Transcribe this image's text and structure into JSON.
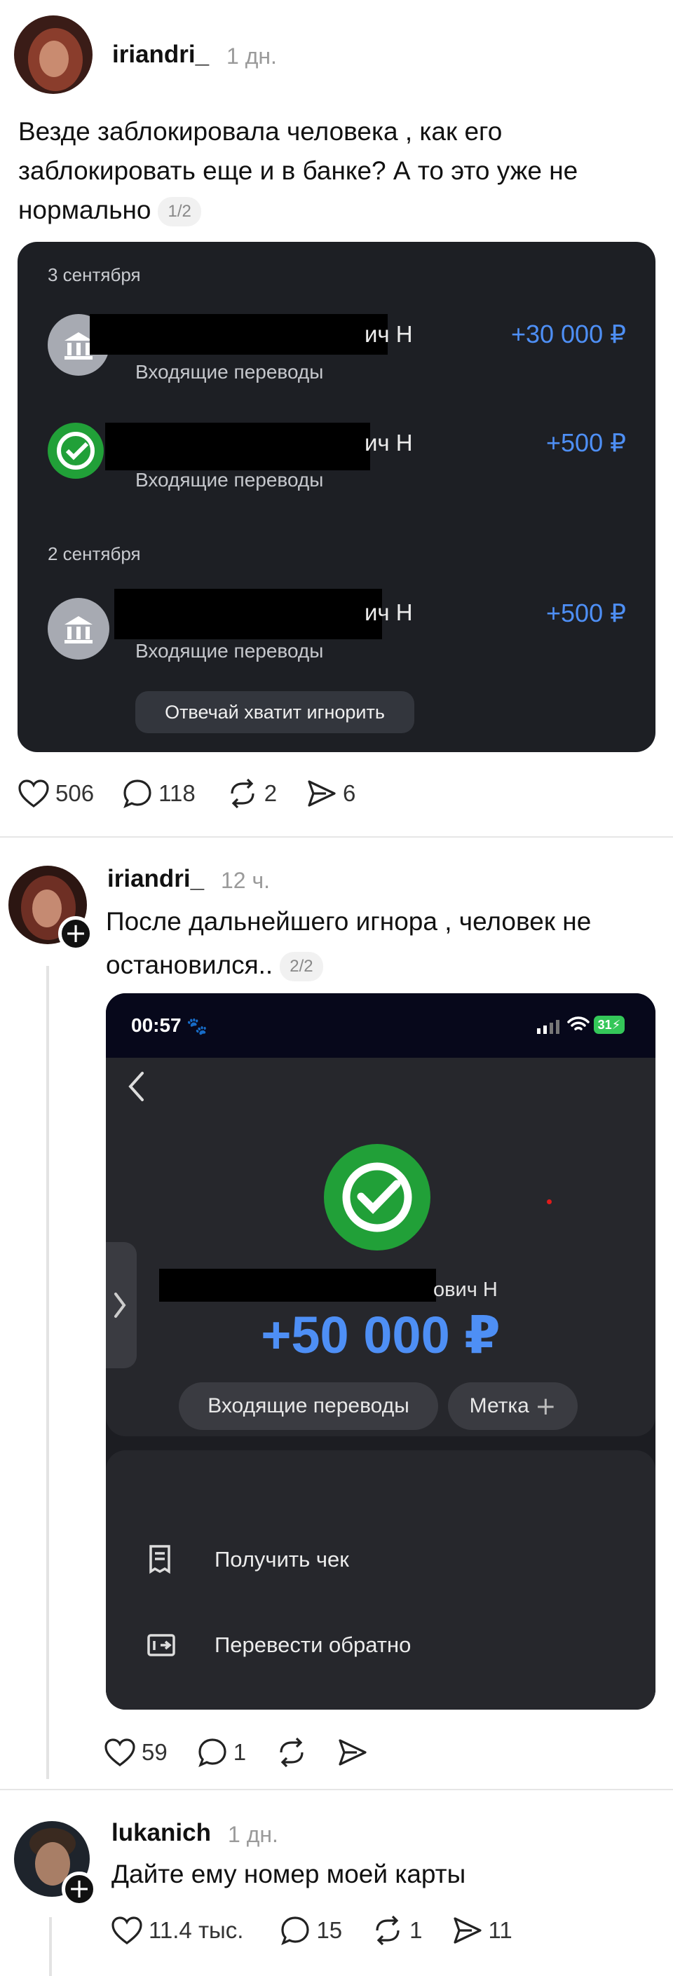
{
  "posts": [
    {
      "username": "iriandri_",
      "time": "1 дн.",
      "text": "Везде заблокировала человека , как его заблокировать еще и в банке? А то это уже не нормально",
      "counter": "1/2",
      "actions": {
        "likes": "506",
        "comments": "118",
        "reposts": "2",
        "shares": "6"
      }
    },
    {
      "username": "iriandri_",
      "time": "12 ч.",
      "text": "После дальнейшего игнора , человек не остановился..",
      "counter": "2/2",
      "actions": {
        "likes": "59",
        "comments": "1"
      }
    },
    {
      "username": "lukanich",
      "time": "1 дн.",
      "text": "Дайте ему номер моей карты",
      "actions": {
        "likes": "11.4 тыс.",
        "comments": "15",
        "reposts": "1",
        "shares": "11"
      }
    }
  ],
  "bank_screenshot": {
    "date1": "3 сентября",
    "date2": "2 сентября",
    "transactions": [
      {
        "name_suffix": "ич Н",
        "type": "Входящие переводы",
        "amount": "+30 000 ₽",
        "icon": "bank-icon"
      },
      {
        "name_suffix": "ич Н",
        "type": "Входящие переводы",
        "amount": "+500 ₽",
        "icon": "sber-icon"
      },
      {
        "name_suffix": "ич Н",
        "type": "Входящие переводы",
        "amount": "+500 ₽",
        "icon": "bank-icon"
      }
    ],
    "message": "Отвечай хватит игнорить"
  },
  "phone_screenshot": {
    "status_time": "00:57",
    "battery": "31",
    "name_suffix": "ович Н",
    "amount": "+50 000 ₽",
    "category_label": "Входящие переводы",
    "tag_label": "Метка",
    "menu": {
      "receipt": "Получить чек",
      "transfer_back": "Перевести обратно"
    }
  },
  "colors": {
    "amount_blue": "#4e8ff5",
    "sber_green": "#21a038",
    "card_dark": "#1d1f24"
  }
}
